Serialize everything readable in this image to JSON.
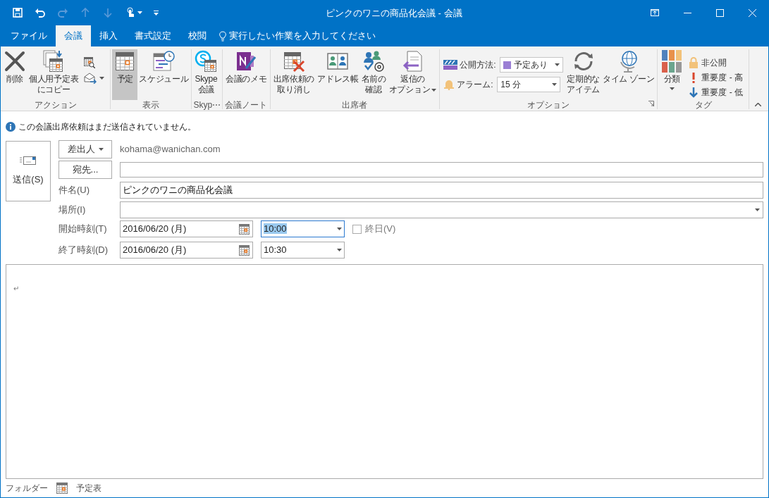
{
  "window": {
    "title": "ピンクのワニの商品化会議 - 会議"
  },
  "quick_access": [
    {
      "disabled": false
    },
    {
      "disabled": false
    },
    {
      "disabled": true
    },
    {
      "disabled": true
    },
    {
      "disabled": true
    },
    {
      "disabled": false
    }
  ],
  "tabs": [
    {
      "label": "ファイル",
      "selected": false
    },
    {
      "label": "会議",
      "selected": true
    },
    {
      "label": "挿入",
      "selected": false
    },
    {
      "label": "書式設定",
      "selected": false
    },
    {
      "label": "校閲",
      "selected": false
    }
  ],
  "tell_me": {
    "placeholder": "実行したい作業を入力してください"
  },
  "ribbon": {
    "groups": [
      {
        "label": "アクション",
        "items": [
          {
            "kind": "large",
            "lines": [
              "削除"
            ]
          },
          {
            "kind": "large",
            "lines": [
              "個人用予定表",
              "にコピー"
            ]
          },
          {
            "kind": "stack",
            "items": [
              {
                "kind": "small"
              },
              {
                "kind": "small",
                "dropdown": true
              }
            ]
          }
        ]
      },
      {
        "label": "表示",
        "items": [
          {
            "kind": "large",
            "lines": [
              "予定"
            ],
            "selected": true
          },
          {
            "kind": "large",
            "lines": [
              "スケジュール"
            ],
            "selected": false
          }
        ]
      },
      {
        "label": "Skyp⋯",
        "items": [
          {
            "kind": "large",
            "lines": [
              "Skype",
              "会議"
            ]
          }
        ]
      },
      {
        "label": "会議ノート",
        "items": [
          {
            "kind": "large",
            "lines": [
              "会議のメモ"
            ]
          }
        ]
      },
      {
        "label": "出席者",
        "items": [
          {
            "kind": "large",
            "lines": [
              "出席依頼の",
              "取り消し"
            ]
          },
          {
            "kind": "large",
            "lines": [
              "アドレス帳"
            ]
          },
          {
            "kind": "large",
            "lines": [
              "名前の",
              "確認"
            ]
          },
          {
            "kind": "large",
            "lines": [
              "返信の",
              "オプション"
            ],
            "dropdown": true
          }
        ]
      },
      {
        "label": "オプション",
        "launcher": true,
        "items": [
          {
            "kind": "stack",
            "items": [
              {
                "kind": "field",
                "label": "公開方法:",
                "value": "予定あり"
              },
              {
                "kind": "field",
                "label": "アラーム:",
                "value": "15 分"
              }
            ]
          },
          {
            "kind": "large",
            "lines": [
              "定期的な",
              "アイテム"
            ]
          },
          {
            "kind": "large",
            "lines": [
              "タイム ゾーン"
            ]
          }
        ]
      },
      {
        "label": "タグ",
        "items": [
          {
            "kind": "large",
            "lines": [
              "分類"
            ],
            "dropdown": true
          },
          {
            "kind": "stack",
            "items": [
              {
                "kind": "small",
                "label": "非公開"
              },
              {
                "kind": "small",
                "label": "重要度 - 高"
              },
              {
                "kind": "small",
                "label": "重要度 - 低"
              }
            ]
          }
        ]
      }
    ]
  },
  "info_bar": {
    "text": "この会議出席依頼はまだ送信されていません。"
  },
  "send_button": {
    "label": "送信(S)"
  },
  "from": {
    "button": "差出人",
    "value": "kohama@wanichan.com"
  },
  "to": {
    "button": "宛先..."
  },
  "subject": {
    "label": "件名(U)",
    "value": "ピンクのワニの商品化会議"
  },
  "location": {
    "label": "場所(I)"
  },
  "start": {
    "label": "開始時刻(T)",
    "date": "2016/06/20 (月)",
    "time": "10:00",
    "focused": true
  },
  "all_day": {
    "label": "終日(V)",
    "checked": false
  },
  "end": {
    "label": "終了時刻(D)",
    "date": "2016/06/20 (月)",
    "time": "10:30",
    "focused": false
  },
  "body": {
    "text": "↵"
  },
  "status_bar": {
    "label": "フォルダー",
    "folder": "予定表"
  }
}
